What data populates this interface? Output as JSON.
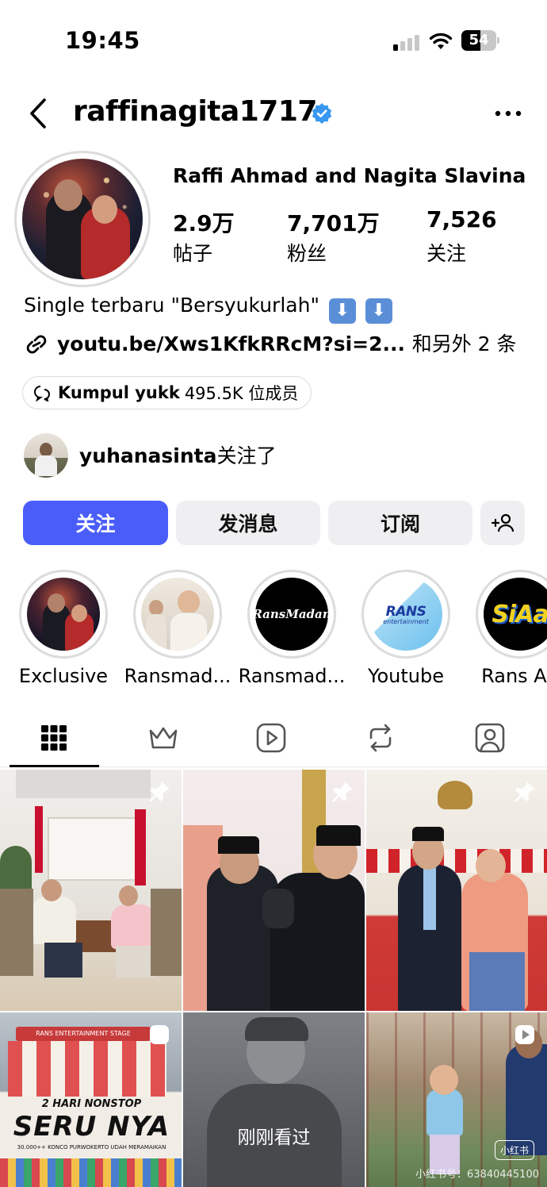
{
  "status_bar": {
    "time": "19:45",
    "battery": "54",
    "battery_level": 0.54
  },
  "header": {
    "username": "raffinagita1717",
    "verified": true,
    "more_icon": "more-dots-icon",
    "back_icon": "chevron-left-icon"
  },
  "profile": {
    "display_name": "Raffi Ahmad and Nagita Slavina",
    "stats": [
      {
        "value": "2.9万",
        "label": "帖子"
      },
      {
        "value": "7,701万",
        "label": "粉丝"
      },
      {
        "value": "7,526",
        "label": "关注"
      }
    ],
    "bio": "Single terbaru \"Bersyukurlah\"",
    "bio_emojis": [
      "⬇",
      "⬇"
    ],
    "link": "youtu.be/Xws1KfkRRcM?si=2...",
    "link_more": "和另外 2 条",
    "channel": {
      "name": "Kumpul yukk",
      "members": "495.5K 位成员"
    },
    "followed_by": {
      "user": "yuhanasinta",
      "suffix": "关注了"
    }
  },
  "actions": {
    "follow": "关注",
    "message": "发消息",
    "subscribe": "订阅"
  },
  "highlights": [
    {
      "label": "Exclusive"
    },
    {
      "label": "Ransmad..."
    },
    {
      "label": "Ransmad...",
      "logo_text": "RansMadan"
    },
    {
      "label": "Youtube",
      "logo_text": "RANS",
      "logo_sub": "entertainment"
    },
    {
      "label": "Rans An",
      "logo_text": "SiAa"
    }
  ],
  "tabs": [
    {
      "name": "grid",
      "icon": "grid-icon",
      "active": true
    },
    {
      "name": "subscriber",
      "icon": "crown-icon",
      "active": false
    },
    {
      "name": "reels",
      "icon": "reels-icon",
      "active": false
    },
    {
      "name": "reposts",
      "icon": "repost-icon",
      "active": false
    },
    {
      "name": "tagged",
      "icon": "tagged-icon",
      "active": false
    }
  ],
  "posts": [
    {
      "type": "chess-meeting",
      "pinned": true
    },
    {
      "type": "handshake",
      "pinned": true
    },
    {
      "type": "couple-formal",
      "pinned": true
    },
    {
      "type": "concert-poster",
      "reel": true,
      "poster_line1": "2 HARI NONSTOP",
      "poster_line2": "SERU NYA",
      "poster_line3": "30.000++ KONCO PURWOKERTO UDAH MERAMAIKAN",
      "banner": "RANS ENTERTAINMENT STAGE"
    },
    {
      "type": "video-watched",
      "overlay": "刚刚看过"
    },
    {
      "type": "playground",
      "reel": true,
      "badge": "小红书",
      "watermark": "小红书号：63840445100"
    }
  ]
}
